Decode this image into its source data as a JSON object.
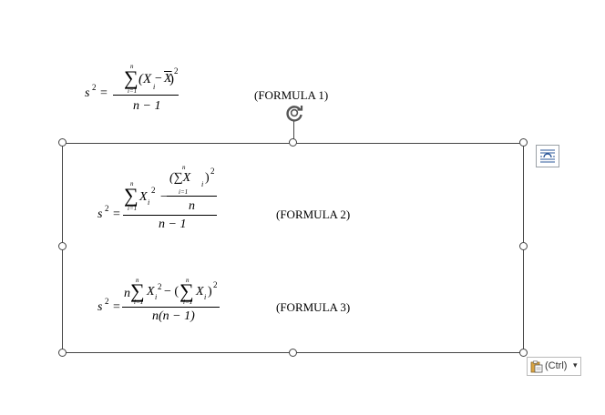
{
  "formula1": {
    "lhs": "s",
    "lhs_sup": "2",
    "eq": "=",
    "sum_top": "n",
    "sum_bottom": "i=1",
    "numerator_paren": "(X",
    "numerator_sub": "i",
    "numerator_minus": " − ",
    "numerator_xbar": "X",
    "numerator_close": ")",
    "numerator_sup": "2",
    "denominator": "n − 1",
    "label": "(FORMULA 1)"
  },
  "formula2": {
    "lhs": "s",
    "lhs_sup": "2",
    "eq": "=",
    "sum_top": "n",
    "sum_bottom": "i=1",
    "term_x": "X",
    "term_sub": "i",
    "term_sup": "2",
    "minus": "−",
    "inner_sum_top": "n",
    "inner_sum_bottom": "i=1",
    "inner_term": "(∑X",
    "inner_sub": "i",
    "inner_close": ")",
    "inner_sup": "2",
    "inner_den": "n",
    "denominator": "n − 1",
    "label": "(FORMULA 2)"
  },
  "formula3": {
    "lhs": "s",
    "lhs_sup": "2",
    "eq": "=",
    "n": "n",
    "sum_top": "n",
    "sum_bottom": "i=1",
    "term_x": "X",
    "term_sub": "i",
    "term_sup": "2",
    "minus": " − (",
    "sum2_top": "n",
    "sum2_bottom": "i=1",
    "term2_x": "X",
    "term2_sub": "i",
    "term2_close": ")",
    "term2_sup": "2",
    "denominator": "n(n − 1)",
    "label": "(FORMULA 3)"
  },
  "paste_options": {
    "label": "(Ctrl)",
    "icon": "clipboard-icon",
    "arrow": "▾"
  },
  "layout_options": {
    "icon": "layout-options-icon"
  },
  "rotate": {
    "icon": "rotate-handle-icon"
  },
  "colors": {
    "frame": "#444444",
    "accent": "#2b579a"
  }
}
